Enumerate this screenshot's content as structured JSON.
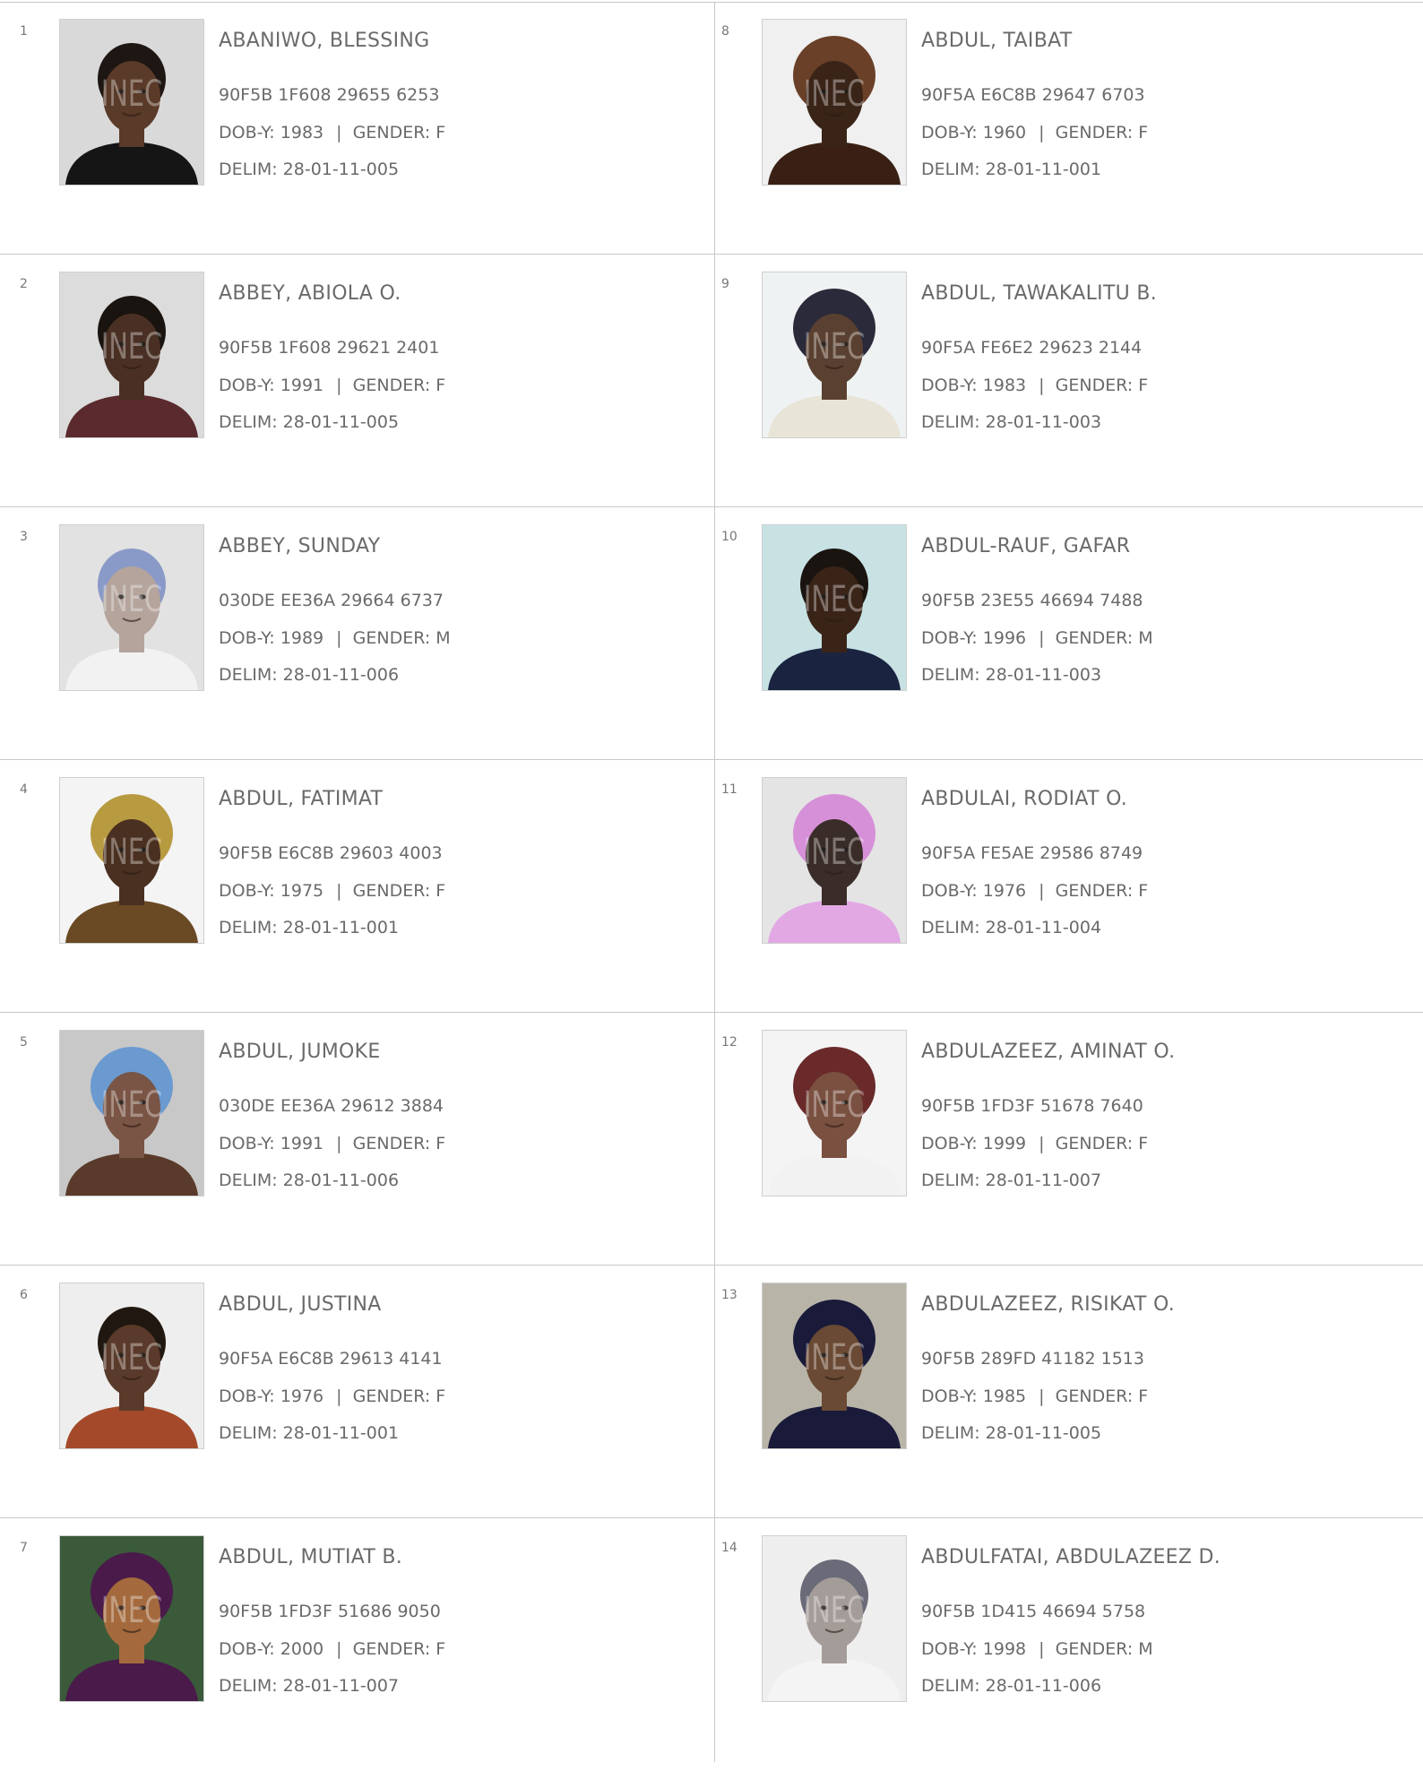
{
  "register": {
    "labels": {
      "dob": "DOB-Y:",
      "gender": "GENDER:",
      "delim": "DELIM:",
      "separator": "|",
      "photo_watermark": "INEC"
    },
    "left_column": [
      {
        "serial": "1",
        "name": "ABANIWO, BLESSING",
        "vin": "90F5B 1F608 29655 6253",
        "dob": "1983",
        "gender": "F",
        "delim": "28-01-11-005",
        "photo": {
          "background": "#d9d9d9",
          "skin": "#5a3a28",
          "hair": "#1e1612",
          "clothing": "#151515",
          "headwrap": false
        }
      },
      {
        "serial": "2",
        "name": "ABBEY, ABIOLA O.",
        "vin": "90F5B 1F608 29621 2401",
        "dob": "1991",
        "gender": "F",
        "delim": "28-01-11-005",
        "photo": {
          "background": "#dcdcdc",
          "skin": "#4a3024",
          "hair": "#1a1410",
          "clothing": "#5a2a2e",
          "headwrap": false
        }
      },
      {
        "serial": "3",
        "name": "ABBEY, SUNDAY",
        "vin": "030DE EE36A 29664 6737",
        "dob": "1989",
        "gender": "M",
        "delim": "28-01-11-006",
        "photo": {
          "background": "#e2e2e2",
          "skin": "#b4a49c",
          "hair": "#8a9ac8",
          "clothing": "#f2f2f2",
          "headwrap": false
        }
      },
      {
        "serial": "4",
        "name": "ABDUL, FATIMAT",
        "vin": "90F5B E6C8B 29603 4003",
        "dob": "1975",
        "gender": "F",
        "delim": "28-01-11-001",
        "photo": {
          "background": "#f4f4f4",
          "skin": "#4a3020",
          "hair": "#b89a40",
          "clothing": "#6a4a24",
          "headwrap": true
        }
      },
      {
        "serial": "5",
        "name": "ABDUL, JUMOKE",
        "vin": "030DE EE36A 29612 3884",
        "dob": "1991",
        "gender": "F",
        "delim": "28-01-11-006",
        "photo": {
          "background": "#c8c8c8",
          "skin": "#7a5444",
          "hair": "#6a9ad0",
          "clothing": "#5a3a2a",
          "headwrap": true
        }
      },
      {
        "serial": "6",
        "name": "ABDUL, JUSTINA",
        "vin": "90F5A E6C8B 29613 4141",
        "dob": "1976",
        "gender": "F",
        "delim": "28-01-11-001",
        "photo": {
          "background": "#eeeeee",
          "skin": "#5a3a2a",
          "hair": "#201810",
          "clothing": "#a44a2a",
          "headwrap": false
        }
      },
      {
        "serial": "7",
        "name": "ABDUL, MUTIAT B.",
        "vin": "90F5B 1FD3F 51686 9050",
        "dob": "2000",
        "gender": "F",
        "delim": "28-01-11-007",
        "photo": {
          "background": "#3a5a3a",
          "skin": "#a46a3e",
          "hair": "#4a1a4a",
          "clothing": "#4a1a4a",
          "headwrap": true
        }
      }
    ],
    "right_column": [
      {
        "serial": "8",
        "name": "ABDUL, TAIBAT",
        "vin": "90F5A E6C8B 29647 6703",
        "dob": "1960",
        "gender": "F",
        "delim": "28-01-11-001",
        "photo": {
          "background": "#f0f0f0",
          "skin": "#3a2418",
          "hair": "#6a4028",
          "clothing": "#3a2014",
          "headwrap": true
        }
      },
      {
        "serial": "9",
        "name": "ABDUL, TAWAKALITU B.",
        "vin": "90F5A FE6E2 29623 2144",
        "dob": "1983",
        "gender": "F",
        "delim": "28-01-11-003",
        "photo": {
          "background": "#eef2f2",
          "skin": "#5a4030",
          "hair": "#2a2a3a",
          "clothing": "#e8e4d8",
          "headwrap": true
        }
      },
      {
        "serial": "10",
        "name": "ABDUL-RAUF, GAFAR",
        "vin": "90F5B 23E55 46694 7488",
        "dob": "1996",
        "gender": "M",
        "delim": "28-01-11-003",
        "photo": {
          "background": "#c8e2e4",
          "skin": "#3a2418",
          "hair": "#1a1410",
          "clothing": "#1a2440",
          "headwrap": false
        }
      },
      {
        "serial": "11",
        "name": "ABDULAI, RODIAT O.",
        "vin": "90F5A FE5AE 29586 8749",
        "dob": "1976",
        "gender": "F",
        "delim": "28-01-11-004",
        "photo": {
          "background": "#e4e4e4",
          "skin": "#3a2c28",
          "hair": "#d690d8",
          "clothing": "#e2a8e4",
          "headwrap": true
        }
      },
      {
        "serial": "12",
        "name": "ABDULAZEEZ, AMINAT O.",
        "vin": "90F5B 1FD3F 51678 7640",
        "dob": "1999",
        "gender": "F",
        "delim": "28-01-11-007",
        "photo": {
          "background": "#f4f4f4",
          "skin": "#7a5040",
          "hair": "#6a2a2a",
          "clothing": "#f2f2f2",
          "headwrap": true
        }
      },
      {
        "serial": "13",
        "name": "ABDULAZEEZ, RISIKAT O.",
        "vin": "90F5B 289FD 41182 1513",
        "dob": "1985",
        "gender": "F",
        "delim": "28-01-11-005",
        "photo": {
          "background": "#b8b4a8",
          "skin": "#6a4a34",
          "hair": "#1a1a3a",
          "clothing": "#1a1a3a",
          "headwrap": true
        }
      },
      {
        "serial": "14",
        "name": "ABDULFATAI, ABDULAZEEZ D.",
        "vin": "90F5B 1D415 46694 5758",
        "dob": "1998",
        "gender": "M",
        "delim": "28-01-11-006",
        "photo": {
          "background": "#eeeeee",
          "skin": "#a49c98",
          "hair": "#6a6a78",
          "clothing": "#f4f4f4",
          "headwrap": false
        }
      }
    ]
  },
  "colors": {
    "text": "#6a6a6a",
    "rule": "#c8c8c8",
    "background": "#ffffff"
  }
}
